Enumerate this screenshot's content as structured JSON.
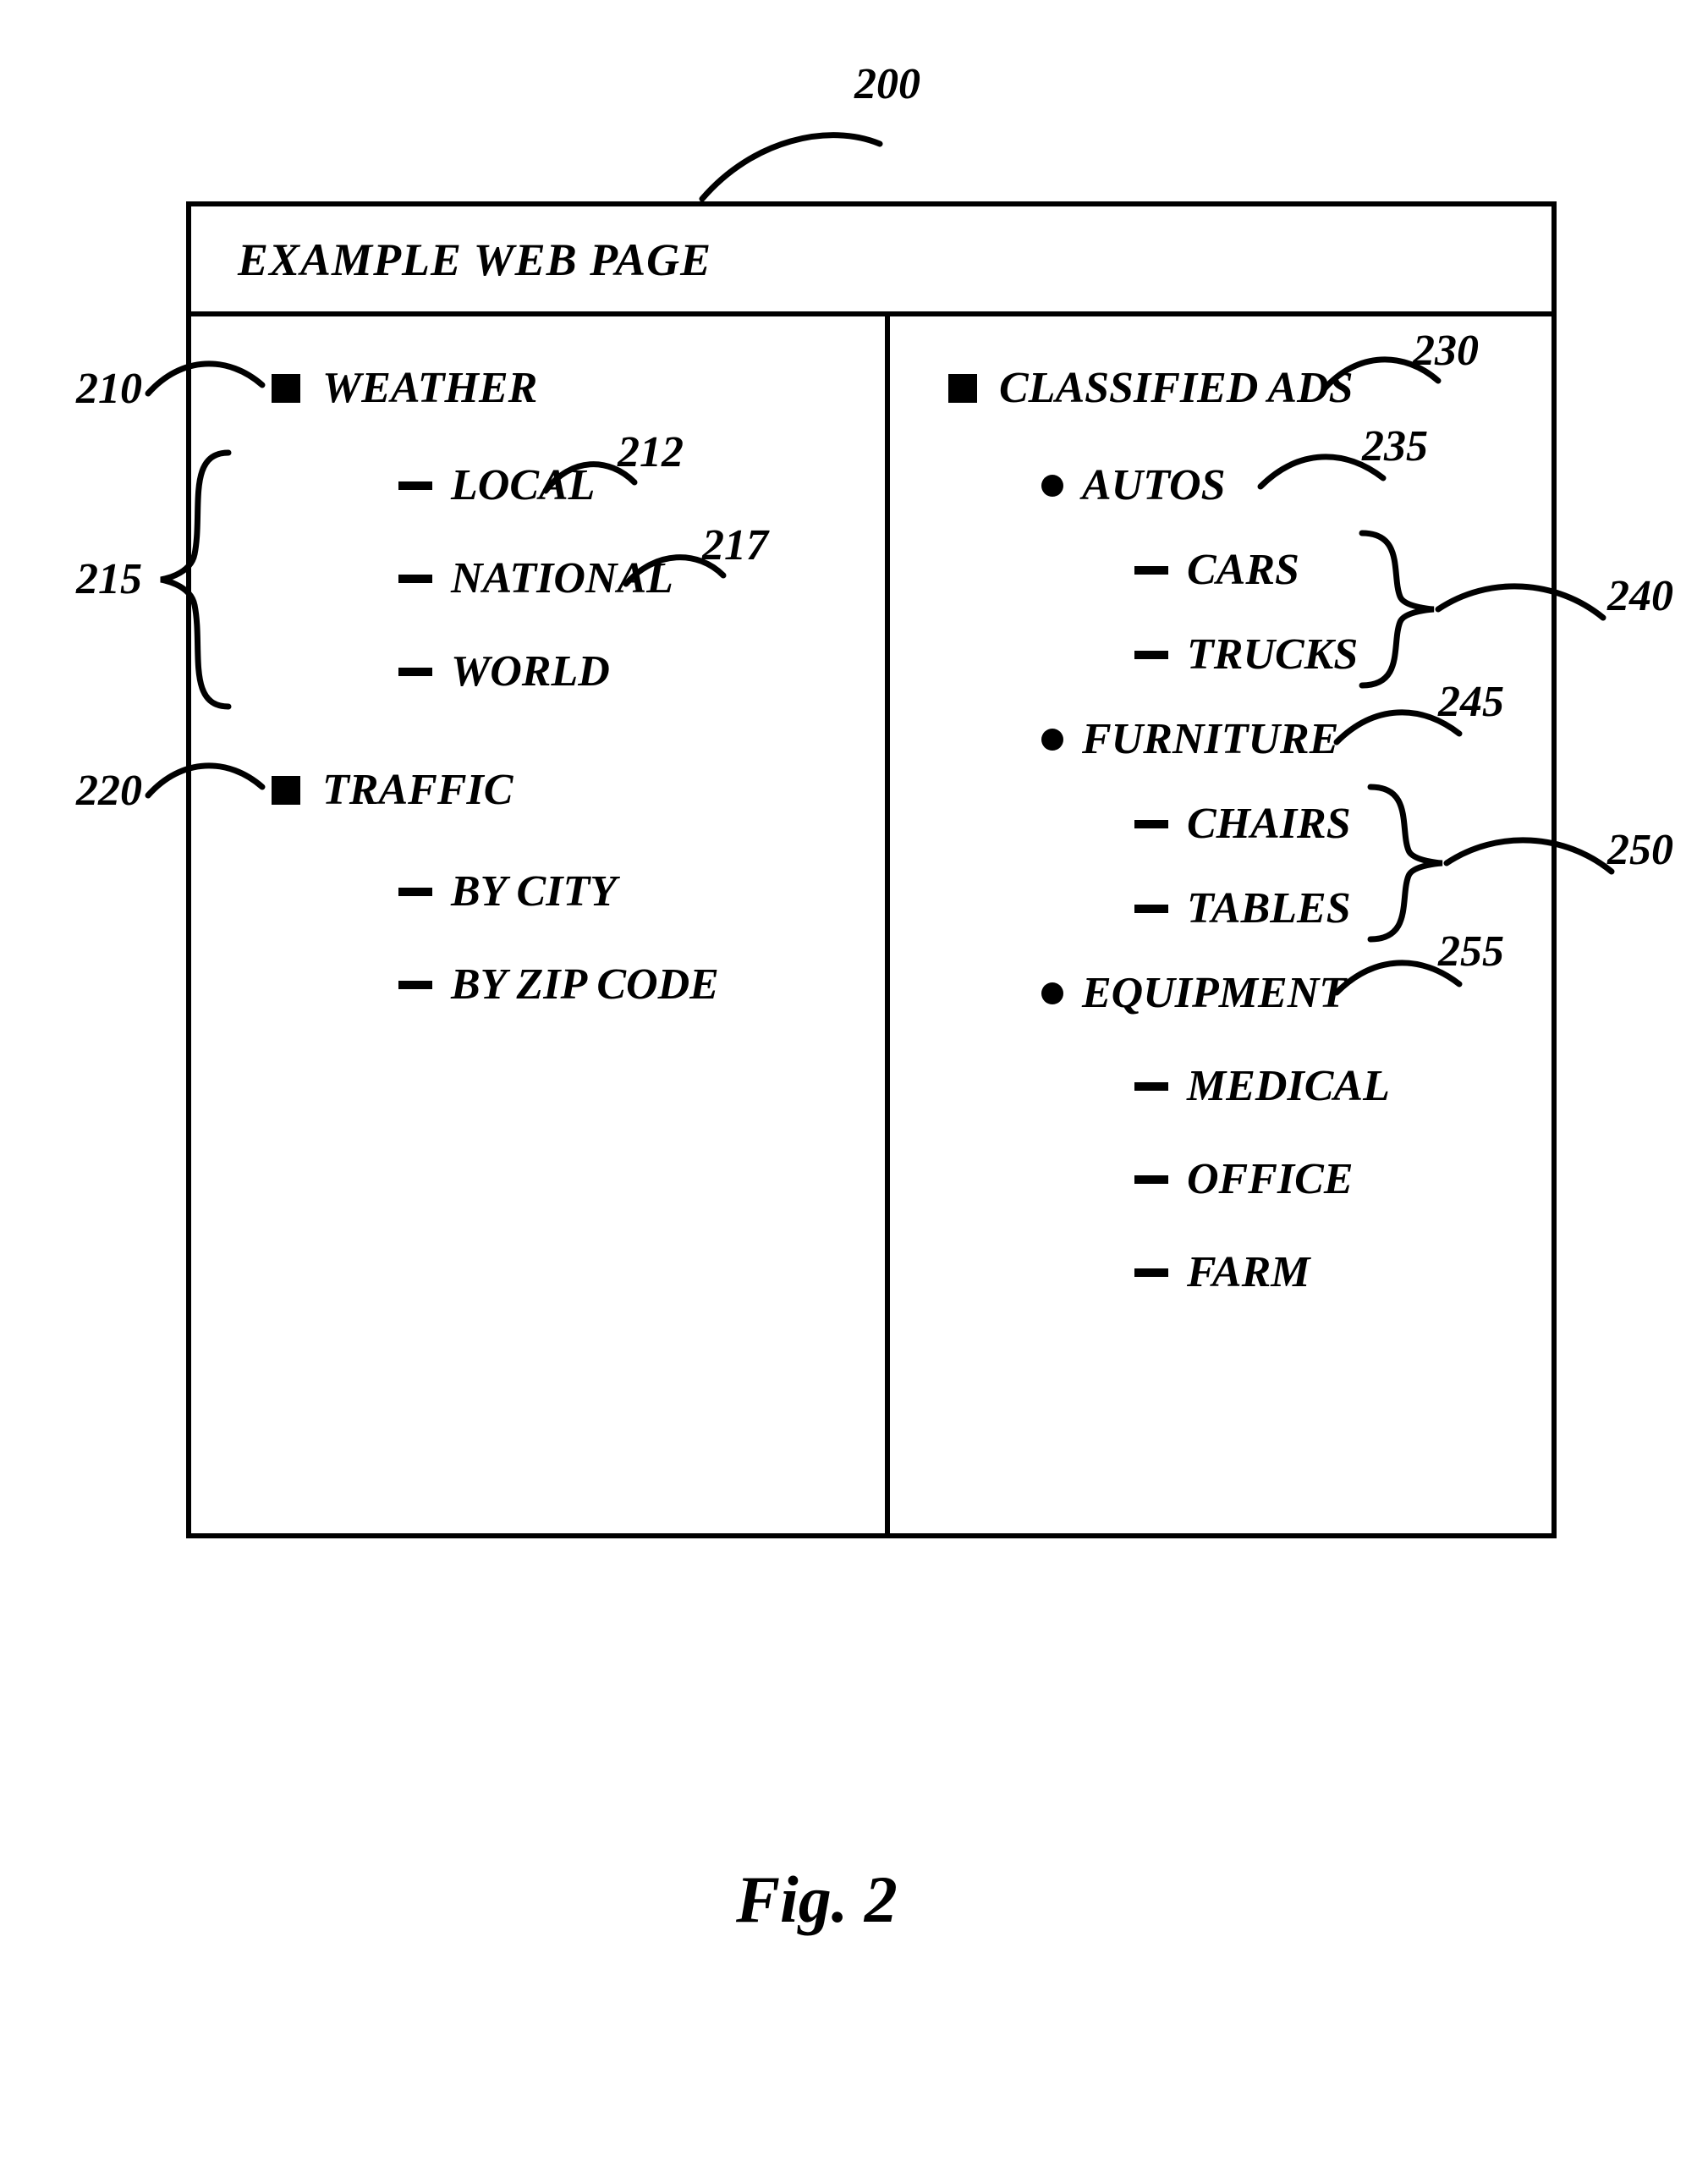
{
  "figure_caption": "Fig. 2",
  "refs": {
    "r200": "200",
    "r210": "210",
    "r212": "212",
    "r215": "215",
    "r217": "217",
    "r220": "220",
    "r230": "230",
    "r235": "235",
    "r240": "240",
    "r245": "245",
    "r250": "250",
    "r255": "255"
  },
  "header": {
    "title": "EXAMPLE WEB PAGE"
  },
  "left": {
    "weather": {
      "label": "WEATHER",
      "items": {
        "local": "LOCAL",
        "national": "NATIONAL",
        "world": "WORLD"
      }
    },
    "traffic": {
      "label": "TRAFFIC",
      "items": {
        "by_city": "BY CITY",
        "by_zip": "BY ZIP CODE"
      }
    }
  },
  "right": {
    "classified": {
      "label": "CLASSIFIED ADS",
      "autos": {
        "label": "AUTOS",
        "items": {
          "cars": "CARS",
          "trucks": "TRUCKS"
        }
      },
      "furniture": {
        "label": "FURNITURE",
        "items": {
          "chairs": "CHAIRS",
          "tables": "TABLES"
        }
      },
      "equipment": {
        "label": "EQUIPMENT",
        "items": {
          "medical": "MEDICAL",
          "office": "OFFICE",
          "farm": "FARM"
        }
      }
    }
  }
}
